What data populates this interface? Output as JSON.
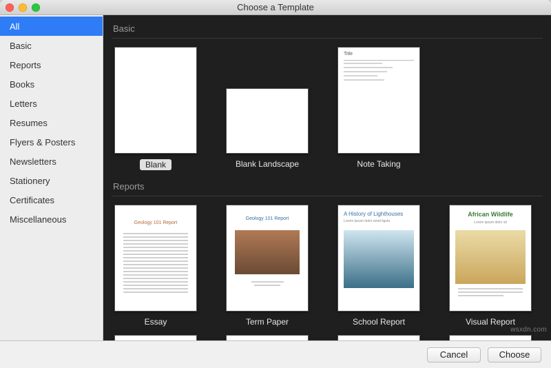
{
  "window": {
    "title": "Choose a Template"
  },
  "sidebar": {
    "items": [
      {
        "label": "All",
        "selected": true
      },
      {
        "label": "Basic"
      },
      {
        "label": "Reports"
      },
      {
        "label": "Books"
      },
      {
        "label": "Letters"
      },
      {
        "label": "Resumes"
      },
      {
        "label": "Flyers & Posters"
      },
      {
        "label": "Newsletters"
      },
      {
        "label": "Stationery"
      },
      {
        "label": "Certificates"
      },
      {
        "label": "Miscellaneous"
      }
    ]
  },
  "sections": {
    "basic": {
      "header": "Basic",
      "templates": [
        {
          "label": "Blank",
          "selected": true
        },
        {
          "label": "Blank Landscape"
        },
        {
          "label": "Note Taking"
        }
      ]
    },
    "reports": {
      "header": "Reports",
      "templates": [
        {
          "label": "Essay"
        },
        {
          "label": "Term Paper"
        },
        {
          "label": "School Report"
        },
        {
          "label": "Visual Report"
        }
      ]
    }
  },
  "thumb_text": {
    "essay_title": "Geology 101 Report",
    "termpaper_title": "Geology 101 Report",
    "school_title": "A History of Lighthouses",
    "school_sub": "Lorem ipsum dolor amet ligula",
    "visual_title": "African Wildlife",
    "visual_sub": "Lorem ipsum dolor sit",
    "note_title": "Title"
  },
  "footer": {
    "cancel": "Cancel",
    "choose": "Choose"
  },
  "watermark": "wsxdn.com"
}
